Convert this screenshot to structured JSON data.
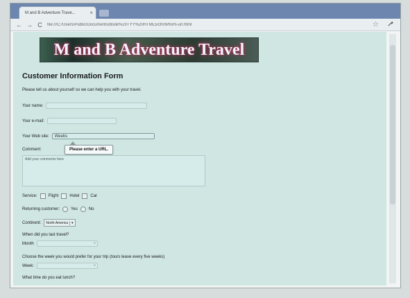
{
  "browser": {
    "tab_title": "M and B Adventure Trave...",
    "tab_close": "×",
    "url": "file:///C:/Users/Public/Documents/Book%20TYY%20HTML5/ch09/form-url.html",
    "nav_back": "←",
    "nav_forward": "→",
    "nav_reload": "C",
    "star": "☆"
  },
  "page": {
    "banner": "M and B Adventure Travel",
    "heading": "Customer Information Form",
    "intro": "Please tell us about yourself so we can help you with your travel.",
    "labels": {
      "name": "Your name:",
      "email": "Your e-mail:",
      "website": "Your Web site:",
      "comment": "Comment:",
      "service": "Service:",
      "returning": "Returning customer:",
      "continent": "Continent:",
      "last_travel": "When did you last travel?",
      "month": "Month",
      "week_question": "Choose the week you would prefer for your trip (tours leave every five weeks)",
      "week": "Week:",
      "lunch": "What time do you eat lunch?"
    },
    "values": {
      "website": "Weebs",
      "comment": "Add your comments here"
    },
    "tooltip": "Please enter a URL.",
    "service_options": [
      "Flight",
      "Hotel",
      "Car"
    ],
    "returning_options": [
      "Yes",
      "No"
    ],
    "continent_selected": "North America",
    "spinner_glyph": "÷"
  }
}
